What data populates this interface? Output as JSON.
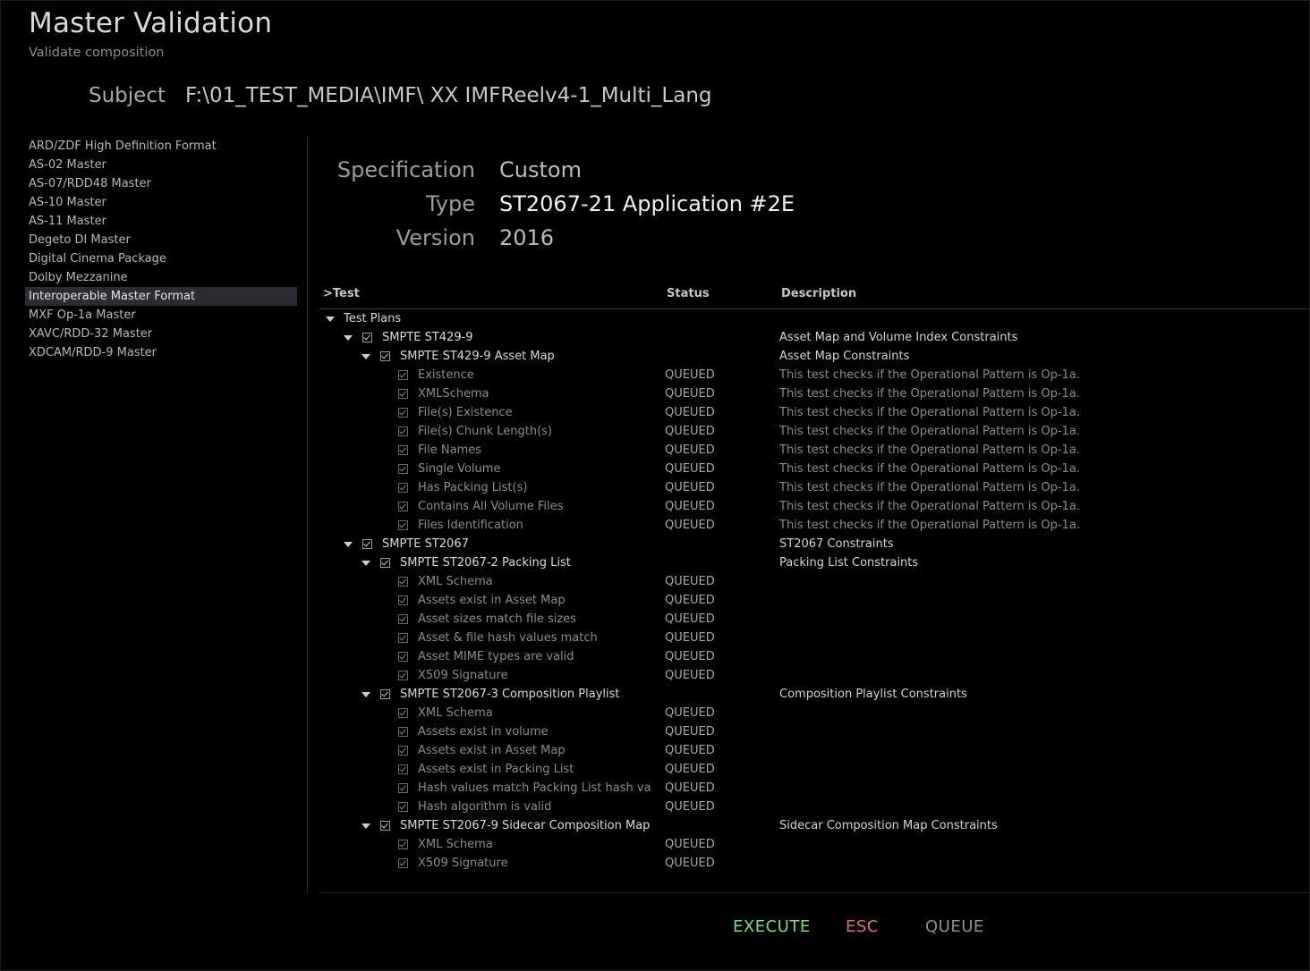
{
  "header": {
    "title": "Master Validation",
    "subtitle": "Validate composition",
    "subject_label": "Subject",
    "subject_value": "F:\\01_TEST_MEDIA\\IMF\\ XX IMFReelv4-1_Multi_Lang"
  },
  "sidebar": {
    "items": [
      {
        "label": "ARD/ZDF High Definition Format",
        "selected": false
      },
      {
        "label": "AS-02 Master",
        "selected": false
      },
      {
        "label": "AS-07/RDD48 Master",
        "selected": false
      },
      {
        "label": "AS-10 Master",
        "selected": false
      },
      {
        "label": "AS-11 Master",
        "selected": false
      },
      {
        "label": "Degeto DI Master",
        "selected": false
      },
      {
        "label": "Digital Cinema Package",
        "selected": false
      },
      {
        "label": "Dolby Mezzanine",
        "selected": false
      },
      {
        "label": "Interoperable Master Format",
        "selected": true
      },
      {
        "label": "MXF Op-1a Master",
        "selected": false
      },
      {
        "label": "XAVC/RDD-32 Master",
        "selected": false
      },
      {
        "label": "XDCAM/RDD-9 Master",
        "selected": false
      }
    ]
  },
  "spec": {
    "specification_label": "Specification",
    "specification_value": "Custom",
    "type_label": "Type",
    "type_value": "ST2067-21 Application #2E",
    "version_label": "Version",
    "version_value": "2016"
  },
  "table": {
    "columns": {
      "test": ">Test",
      "status": "Status",
      "description": "Description"
    },
    "rows": [
      {
        "level": 0,
        "kind": "root",
        "label": "Test Plans",
        "status": "",
        "desc": ""
      },
      {
        "level": 1,
        "kind": "group",
        "label": "SMPTE ST429-9",
        "status": "",
        "desc": "Asset Map and Volume Index Constraints"
      },
      {
        "level": 2,
        "kind": "group",
        "label": "SMPTE ST429-9 Asset Map",
        "status": "",
        "desc": "Asset Map Constraints"
      },
      {
        "level": 3,
        "kind": "leaf",
        "label": "Existence",
        "status": "QUEUED",
        "desc": "This test checks if the Operational Pattern is Op-1a."
      },
      {
        "level": 3,
        "kind": "leaf",
        "label": "XMLSchema",
        "status": "QUEUED",
        "desc": "This test checks if the Operational Pattern is Op-1a."
      },
      {
        "level": 3,
        "kind": "leaf",
        "label": "File(s) Existence",
        "status": "QUEUED",
        "desc": "This test checks if the Operational Pattern is Op-1a."
      },
      {
        "level": 3,
        "kind": "leaf",
        "label": "File(s) Chunk Length(s)",
        "status": "QUEUED",
        "desc": "This test checks if the Operational Pattern is Op-1a."
      },
      {
        "level": 3,
        "kind": "leaf",
        "label": "File Names",
        "status": "QUEUED",
        "desc": "This test checks if the Operational Pattern is Op-1a."
      },
      {
        "level": 3,
        "kind": "leaf",
        "label": "Single Volume",
        "status": "QUEUED",
        "desc": "This test checks if the Operational Pattern is Op-1a."
      },
      {
        "level": 3,
        "kind": "leaf",
        "label": "Has Packing List(s)",
        "status": "QUEUED",
        "desc": "This test checks if the Operational Pattern is Op-1a."
      },
      {
        "level": 3,
        "kind": "leaf",
        "label": "Contains All Volume Files",
        "status": "QUEUED",
        "desc": "This test checks if the Operational Pattern is Op-1a."
      },
      {
        "level": 3,
        "kind": "leaf",
        "label": "Files Identification",
        "status": "QUEUED",
        "desc": "This test checks if the Operational Pattern is Op-1a."
      },
      {
        "level": 1,
        "kind": "group",
        "label": "SMPTE ST2067",
        "status": "",
        "desc": "ST2067 Constraints"
      },
      {
        "level": 2,
        "kind": "group",
        "label": "SMPTE ST2067-2 Packing List",
        "status": "",
        "desc": "Packing List Constraints"
      },
      {
        "level": 3,
        "kind": "leaf",
        "label": "XML Schema",
        "status": "QUEUED",
        "desc": ""
      },
      {
        "level": 3,
        "kind": "leaf",
        "label": "Assets exist in Asset Map",
        "status": "QUEUED",
        "desc": ""
      },
      {
        "level": 3,
        "kind": "leaf",
        "label": "Asset sizes match file sizes",
        "status": "QUEUED",
        "desc": ""
      },
      {
        "level": 3,
        "kind": "leaf",
        "label": "Asset & file hash values match",
        "status": "QUEUED",
        "desc": ""
      },
      {
        "level": 3,
        "kind": "leaf",
        "label": "Asset MIME types are valid",
        "status": "QUEUED",
        "desc": ""
      },
      {
        "level": 3,
        "kind": "leaf",
        "label": "X509 Signature",
        "status": "QUEUED",
        "desc": ""
      },
      {
        "level": 2,
        "kind": "group",
        "label": "SMPTE ST2067-3 Composition Playlist",
        "status": "",
        "desc": "Composition Playlist Constraints"
      },
      {
        "level": 3,
        "kind": "leaf",
        "label": "XML Schema",
        "status": "QUEUED",
        "desc": ""
      },
      {
        "level": 3,
        "kind": "leaf",
        "label": "Assets exist in volume",
        "status": "QUEUED",
        "desc": ""
      },
      {
        "level": 3,
        "kind": "leaf",
        "label": "Assets exist in Asset Map",
        "status": "QUEUED",
        "desc": ""
      },
      {
        "level": 3,
        "kind": "leaf",
        "label": "Assets exist in Packing List",
        "status": "QUEUED",
        "desc": ""
      },
      {
        "level": 3,
        "kind": "leaf",
        "label": "Hash values match Packing List hash va...",
        "status": "QUEUED",
        "desc": ""
      },
      {
        "level": 3,
        "kind": "leaf",
        "label": "Hash algorithm is valid",
        "status": "QUEUED",
        "desc": ""
      },
      {
        "level": 2,
        "kind": "group",
        "label": "SMPTE ST2067-9 Sidecar Composition Map",
        "status": "",
        "desc": "Sidecar Composition Map Constraints"
      },
      {
        "level": 3,
        "kind": "leaf",
        "label": "XML Schema",
        "status": "QUEUED",
        "desc": ""
      },
      {
        "level": 3,
        "kind": "leaf",
        "label": "X509 Signature",
        "status": "QUEUED",
        "desc": ""
      }
    ]
  },
  "buttons": {
    "execute": "EXECUTE",
    "esc": "ESC",
    "queue": "QUEUE"
  },
  "colors": {
    "execute": "#7edb7e",
    "esc": "#e07070",
    "queue": "#8e8e8e",
    "selected_bg": "#2b2b33"
  }
}
